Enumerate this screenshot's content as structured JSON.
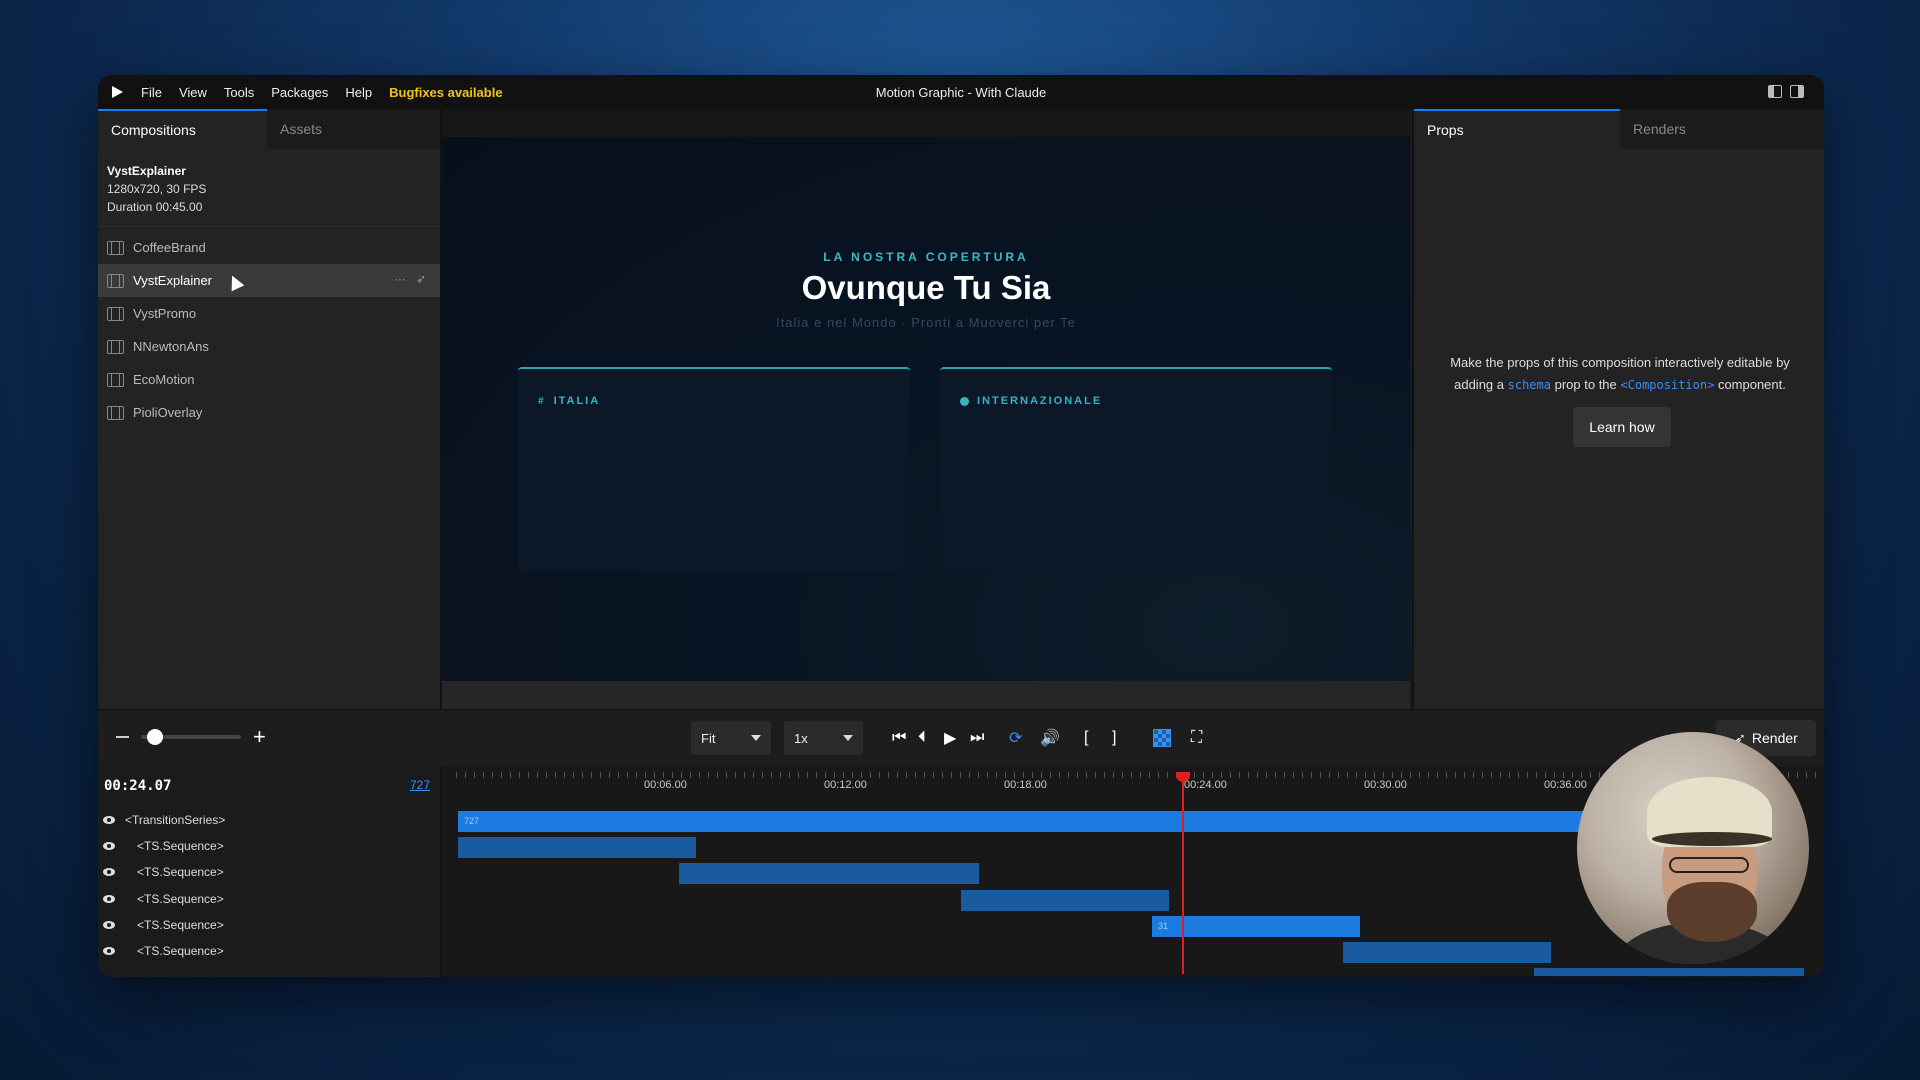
{
  "menubar": {
    "items": [
      "File",
      "View",
      "Tools",
      "Packages",
      "Help"
    ],
    "bugfix": "Bugfixes available",
    "title": "Motion Graphic - With Claude"
  },
  "left_panel": {
    "tabs": [
      "Compositions",
      "Assets"
    ],
    "info": {
      "name": "VystExplainer",
      "specs": "1280x720, 30 FPS",
      "duration": "Duration 00:45.00"
    },
    "compositions": [
      "CoffeeBrand",
      "VystExplainer",
      "VystPromo",
      "NNewtonAns",
      "EcoMotion",
      "PioliOverlay"
    ],
    "selected_index": 1
  },
  "preview": {
    "kicker": "LA NOSTRA COPERTURA",
    "headline": "Ovunque Tu Sia",
    "subline": "Italia e nel Mondo · Pronti a Muoverci per Te",
    "card_left": "ITALIA",
    "card_right": "INTERNAZIONALE"
  },
  "right_panel": {
    "tabs": [
      "Props",
      "Renders"
    ],
    "msg_part1": "Make the props of this composition interactively editable by adding a",
    "msg_code1": "schema",
    "msg_part2": "prop to the",
    "msg_code2": "<Composition>",
    "msg_part3": "component.",
    "learn_button": "Learn how"
  },
  "controls": {
    "fit": "Fit",
    "speed": "1x",
    "render": "Render"
  },
  "timeline": {
    "timecode": "00:24.07",
    "frame": "727",
    "ticks": [
      "00:06.00",
      "00:12.00",
      "00:18.00",
      "00:24.00",
      "00:30.00",
      "00:36.00"
    ],
    "tracks": [
      "<TransitionSeries>",
      "<TS.Sequence>",
      "<TS.Sequence>",
      "<TS.Sequence>",
      "<TS.Sequence>",
      "<TS.Sequence>"
    ],
    "bar_label_main": "727",
    "bar_label_active": "31"
  },
  "colors": {
    "accent": "#0b84f3",
    "bugfix": "#f0c419",
    "playhead": "#e02020",
    "teal": "#3fb9c4"
  }
}
